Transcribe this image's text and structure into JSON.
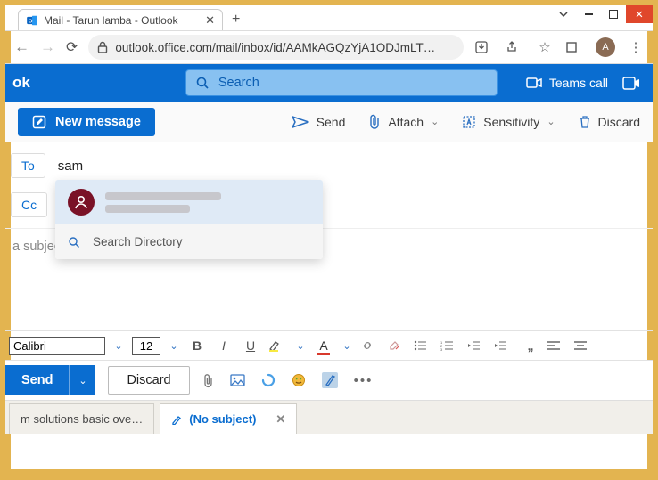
{
  "window": {
    "tab_title": "Mail - Tarun lamba - Outlook",
    "controls": {
      "minimize": "min",
      "maximize": "max",
      "close": "✕"
    }
  },
  "addressbar": {
    "url": "outlook.office.com/mail/inbox/id/AAMkAGQzYjA1ODJmLT…",
    "avatar_letter": "A"
  },
  "appbar": {
    "brand": "ok",
    "search_placeholder": "Search",
    "teams_call": "Teams call"
  },
  "toolbar": {
    "new_message": "New message",
    "send": "Send",
    "attach": "Attach",
    "sensitivity": "Sensitivity",
    "discard": "Discard"
  },
  "compose": {
    "to_label": "To",
    "cc_label": "Cc",
    "to_value": "sam",
    "subject_placeholder": "a subject",
    "suggestion": {
      "search_directory": "Search Directory"
    }
  },
  "formatbar": {
    "font": "Calibri",
    "size": "12"
  },
  "sendbar": {
    "send": "Send",
    "discard": "Discard"
  },
  "tabs": {
    "inactive": "m solutions basic ove…",
    "active": "(No subject)"
  }
}
